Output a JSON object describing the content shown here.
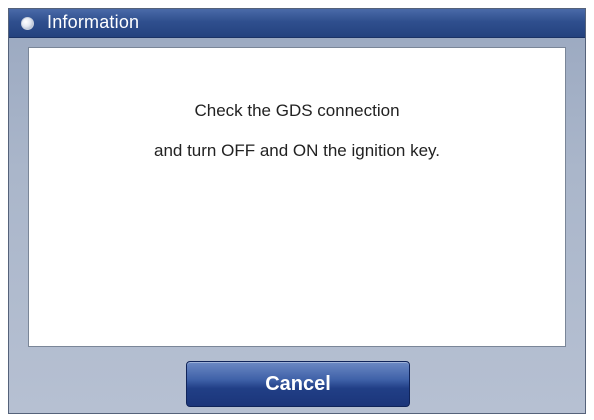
{
  "dialog": {
    "title": "Information",
    "icon": "bullet-icon",
    "message_lines": [
      "Check the GDS connection",
      "and turn OFF and ON the ignition key."
    ],
    "cancel_label": "Cancel"
  },
  "colors": {
    "titlebar": "#2f4f8e",
    "button": "#213f86",
    "frame": "#aab6ca"
  }
}
